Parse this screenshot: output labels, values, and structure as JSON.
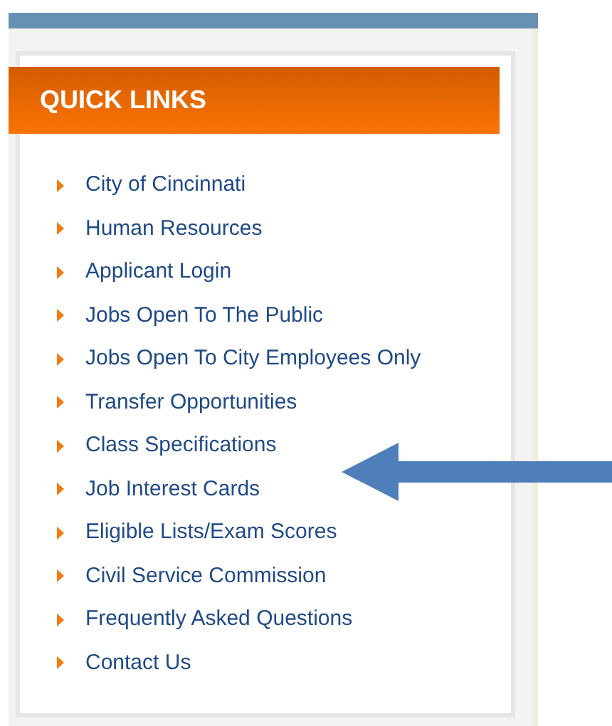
{
  "panel": {
    "title": "QUICK LINKS"
  },
  "links": [
    {
      "label": "City of Cincinnati"
    },
    {
      "label": "Human Resources"
    },
    {
      "label": "Applicant Login"
    },
    {
      "label": "Jobs Open To The Public"
    },
    {
      "label": "Jobs Open To City Employees Only"
    },
    {
      "label": "Transfer Opportunities"
    },
    {
      "label": "Class Specifications"
    },
    {
      "label": "Job Interest Cards"
    },
    {
      "label": "Eligible Lists/Exam Scores"
    },
    {
      "label": "Civil Service Commission"
    },
    {
      "label": "Frequently Asked Questions"
    },
    {
      "label": "Contact Us"
    }
  ]
}
